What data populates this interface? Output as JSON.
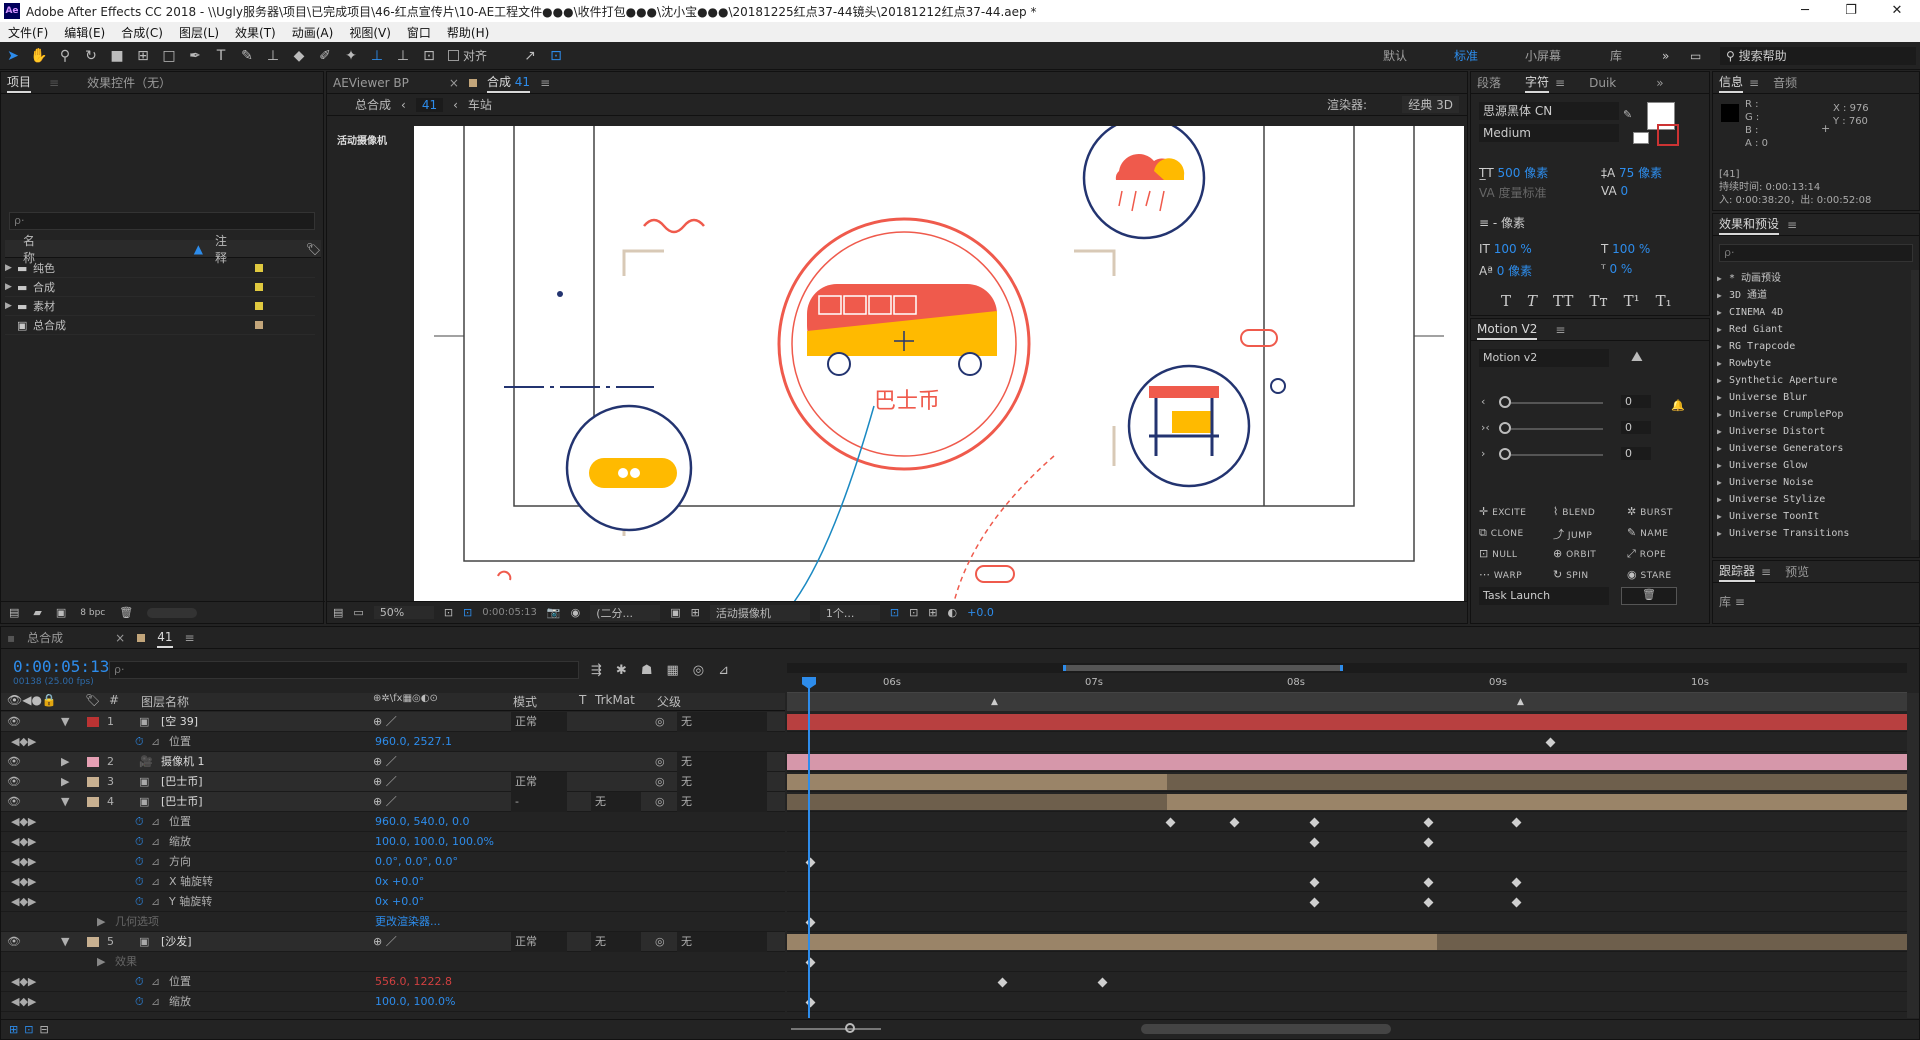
{
  "app": {
    "title": "Adobe After Effects CC 2018 - \\\\Ugly服务器\\项目\\已完成项目\\46-红点宣传片\\10-AE工程文件●●●\\收件打包●●●\\沈小宝●●●\\20181225红点37-44镜头\\20181212红点37-44.aep *",
    "logo": "Ae"
  },
  "menu": [
    "文件(F)",
    "编辑(E)",
    "合成(C)",
    "图层(L)",
    "效果(T)",
    "动画(A)",
    "视图(V)",
    "窗口",
    "帮助(H)"
  ],
  "toolbar": {
    "align_label": "对齐"
  },
  "workspaces": [
    "默认",
    "标准",
    "小屏幕",
    "库"
  ],
  "help_search": "搜索帮助",
  "project": {
    "tab": "项目",
    "tab2": "效果控件（无）",
    "search_placeholder": "ρ·",
    "col_name": "名称",
    "col_note": "注释",
    "items": [
      {
        "name": "纯色",
        "color": "#e0c93f"
      },
      {
        "name": "合成",
        "color": "#e0c93f"
      },
      {
        "name": "素材",
        "color": "#e0c93f"
      },
      {
        "name": "总合成",
        "color": "#c2a57a"
      }
    ],
    "bpc": "8 bpc"
  },
  "viewer": {
    "tab_viewer": "AEViewer BP",
    "tab_comp": "合成",
    "comp_num": "41",
    "crumb1": "总合成",
    "crumb2": "41",
    "crumb3": "车站",
    "renderer_label": "渲染器:",
    "renderer": "经典 3D",
    "camera_label": "活动摄像机",
    "bus_text": "巴士币",
    "zoom": "50%",
    "timecode": "0:00:05:13",
    "resolution": "(二分...",
    "view_mode": "活动摄像机",
    "views": "1个...",
    "exposure": "+0.0"
  },
  "character": {
    "tab1": "段落",
    "tab2": "字符",
    "tab3": "Duik",
    "font": "思源黑体 CN",
    "style": "Medium",
    "size": "500 像素",
    "leading": "75 像素",
    "kerning": "度量标准",
    "tracking": "0",
    "stroke": "- 像素",
    "vscale": "100 %",
    "hscale": "100 %",
    "baseline": "0 像素",
    "tsume": "0 %"
  },
  "motion": {
    "title": "Motion V2",
    "dropdown": "Motion v2",
    "values": [
      "0",
      "0",
      "0"
    ],
    "buttons": [
      "EXCITE",
      "BLEND",
      "BURST",
      "CLONE",
      "JUMP",
      "NAME",
      "NULL",
      "ORBIT",
      "ROPE",
      "WARP",
      "SPIN",
      "STARE"
    ],
    "task": "Task Launch"
  },
  "info": {
    "tab1": "信息",
    "tab2": "音频",
    "r": "R :",
    "g": "G :",
    "b": "B :",
    "a": "A : 0",
    "x": "X : 976",
    "y": "Y : 760",
    "comp": "[41]",
    "duration": "持续时间: 0:00:13:14",
    "inout": "入: 0:00:38:20，出: 0:00:52:08"
  },
  "effects": {
    "title": "效果和预设",
    "items": [
      "* 动画预设",
      "3D 通道",
      "CINEMA 4D",
      "Red Giant",
      "RG Trapcode",
      "Rowbyte",
      "Synthetic Aperture",
      "Universe Blur",
      "Universe CrumplePop",
      "Universe Distort",
      "Universe Generators",
      "Universe Glow",
      "Universe Noise",
      "Universe Stylize",
      "Universe ToonIt",
      "Universe Transitions"
    ]
  },
  "tracker": {
    "tab1": "跟踪器",
    "tab2": "预览",
    "lib": "库"
  },
  "timeline": {
    "tab1": "总合成",
    "tab2": "41",
    "timecode": "0:00:05:13",
    "fps": "00138 (25.00 fps)",
    "col_layer": "图层名称",
    "col_mode": "模式",
    "col_t": "T",
    "col_trk": "TrkMat",
    "col_parent": "父级",
    "ruler": [
      "06s",
      "07s",
      "08s",
      "09s",
      "10s"
    ],
    "rows": [
      {
        "type": "layer",
        "num": "1",
        "name": "[空 39]",
        "color": "#b33",
        "mode": "正常",
        "parent": "无"
      },
      {
        "type": "prop",
        "name": "位置",
        "value": "960.0, 2527.1"
      },
      {
        "type": "layer",
        "num": "2",
        "name": "摄像机 1",
        "color": "#e6a0b4",
        "mode": "",
        "parent": "无"
      },
      {
        "type": "layer",
        "num": "3",
        "name": "[巴士币]",
        "color": "#c8b090",
        "mode": "正常",
        "parent": "无"
      },
      {
        "type": "layer",
        "num": "4",
        "name": "[巴士币]",
        "color": "#c8b090",
        "mode": "-",
        "trk": "无",
        "parent": "无"
      },
      {
        "type": "prop",
        "name": "位置",
        "value": "960.0, 540.0, 0.0"
      },
      {
        "type": "prop",
        "name": "缩放",
        "value": "100.0, 100.0, 100.0%"
      },
      {
        "type": "prop",
        "name": "方向",
        "value": "0.0°, 0.0°, 0.0°"
      },
      {
        "type": "prop",
        "name": "X 轴旋转",
        "value": "0x +0.0°"
      },
      {
        "type": "prop",
        "name": "Y 轴旋转",
        "value": "0x +0.0°"
      },
      {
        "type": "sub",
        "name": "几何选项",
        "value": "更改渲染器..."
      },
      {
        "type": "layer",
        "num": "5",
        "name": "[沙发]",
        "color": "#c8b090",
        "mode": "正常",
        "trk": "无",
        "parent": "无"
      },
      {
        "type": "sub",
        "name": "效果",
        "value": ""
      },
      {
        "type": "prop",
        "name": "位置",
        "value": "556.0, 1222.8"
      },
      {
        "type": "prop",
        "name": "缩放",
        "value": "100.0, 100.0%"
      }
    ]
  }
}
